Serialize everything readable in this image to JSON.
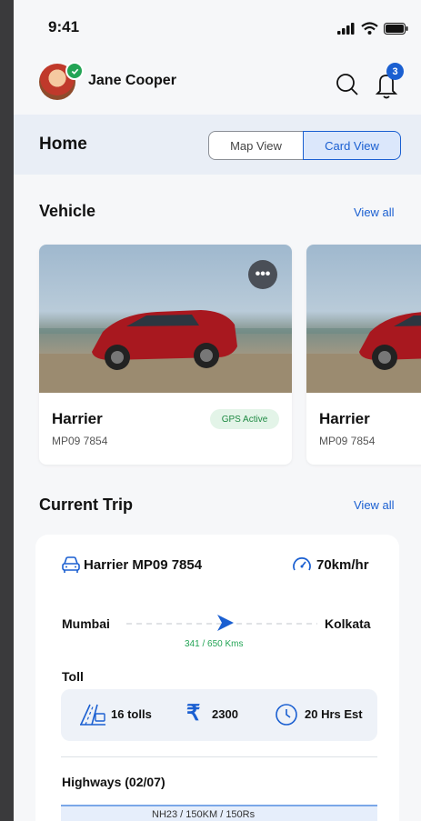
{
  "status_bar": {
    "time": "9:41"
  },
  "profile": {
    "name": "Jane Cooper",
    "notification_count": "3"
  },
  "header": {
    "title": "Home",
    "view_toggle": {
      "options": [
        "Map View",
        "Card View"
      ],
      "selected": "Card View"
    }
  },
  "vehicles": {
    "title": "Vehicle",
    "view_all": "View all",
    "items": [
      {
        "name": "Harrier",
        "plate": "MP09 7854",
        "status": "GPS Active"
      },
      {
        "name": "Harrier",
        "plate": "MP09 7854"
      }
    ]
  },
  "current_trip": {
    "title": "Current Trip",
    "view_all": "View all",
    "vehicle": "Harrier MP09 7854",
    "speed": "70km/hr",
    "from": "Mumbai",
    "to": "Kolkata",
    "distance": "341 / 650 Kms",
    "distance_progress": 0.52,
    "toll_label": "Toll",
    "tolls": "16 tolls",
    "toll_cost": "2300",
    "eta": "20 Hrs Est",
    "highways_label": "Highways (02/07)",
    "highway_preview": "NH23 / 150KM / 150Rs"
  },
  "colors": {
    "accent": "#1a5fd1",
    "success": "#23a455",
    "background": "#f6f7f9"
  }
}
